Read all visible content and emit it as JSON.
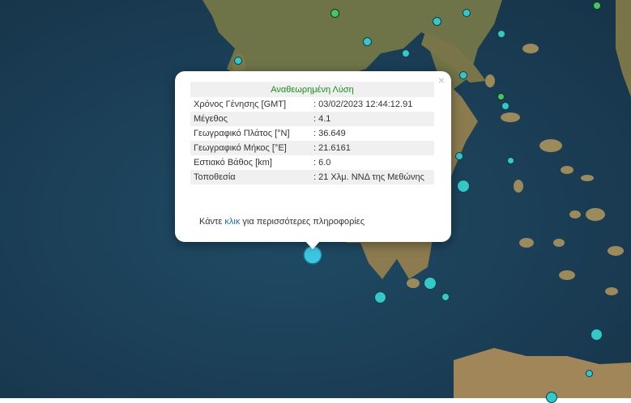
{
  "colors": {
    "sea_dark": "#1b3b52",
    "sea_mid": "#22506a",
    "land": "#a48a60",
    "land_dark": "#5d6b3d",
    "quake_cyan": "#36c7c8",
    "quake_green": "#49c36a",
    "header_green": "#1c8a1c",
    "link_blue": "#1d6fa5"
  },
  "popup": {
    "close_label": "×",
    "header": "Αναθεωρημένη Λύση",
    "rows": [
      {
        "label": "Χρόνος Γένησης [GMT]",
        "value": ": 03/02/2023 12:44:12.91"
      },
      {
        "label": "Μέγεθος",
        "value": ": 4.1"
      },
      {
        "label": "Γεωγραφικό Πλάτος [°N]",
        "value": ": 36.649"
      },
      {
        "label": "Γεωγραφικό Μήκος [°E]",
        "value": ": 21.6161"
      },
      {
        "label": "Εστιακό Βάθος [km]",
        "value": ": 6.0"
      },
      {
        "label": "Τοποθεσία",
        "value": ": 21 Χλμ. ΝΝΔ της Μεθώνης"
      }
    ],
    "more_prefix": "Κάντε",
    "more_link": "κλικ",
    "more_suffix": "για περισσότερες πληροφορίες"
  },
  "selected_marker_icon": "map-marker-icon"
}
